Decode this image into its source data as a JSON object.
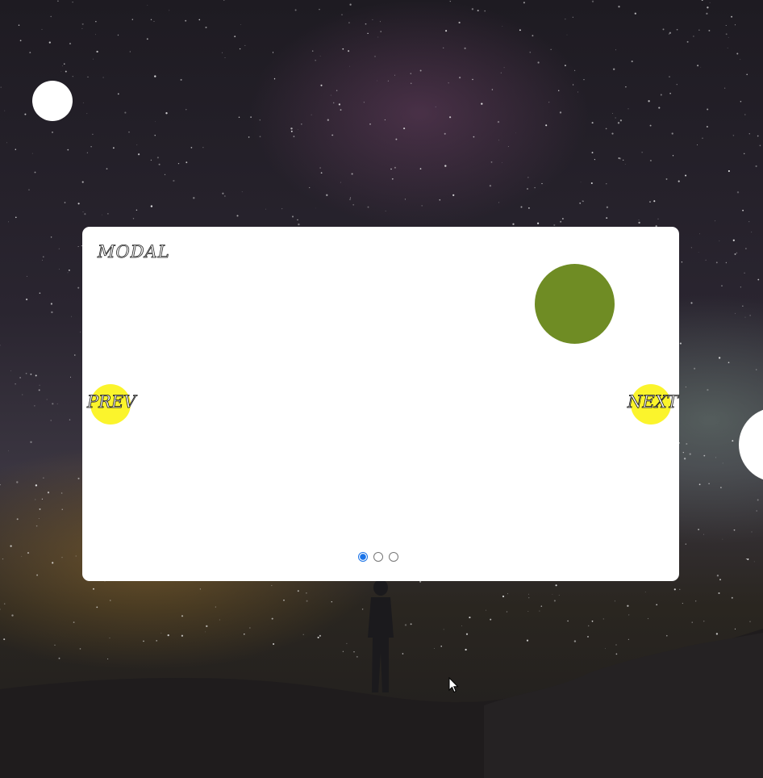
{
  "modal": {
    "title": "MODAL",
    "prev_label": "PREV",
    "next_label": "NEXT",
    "pagination": {
      "count": 3,
      "active_index": 0
    }
  },
  "colors": {
    "modal_background": "#ffffff",
    "nav_button": "#fbf42c",
    "green_circle": "#6f8c24",
    "active_dot": "#1a73e8",
    "floating_circle": "#ffffff"
  }
}
